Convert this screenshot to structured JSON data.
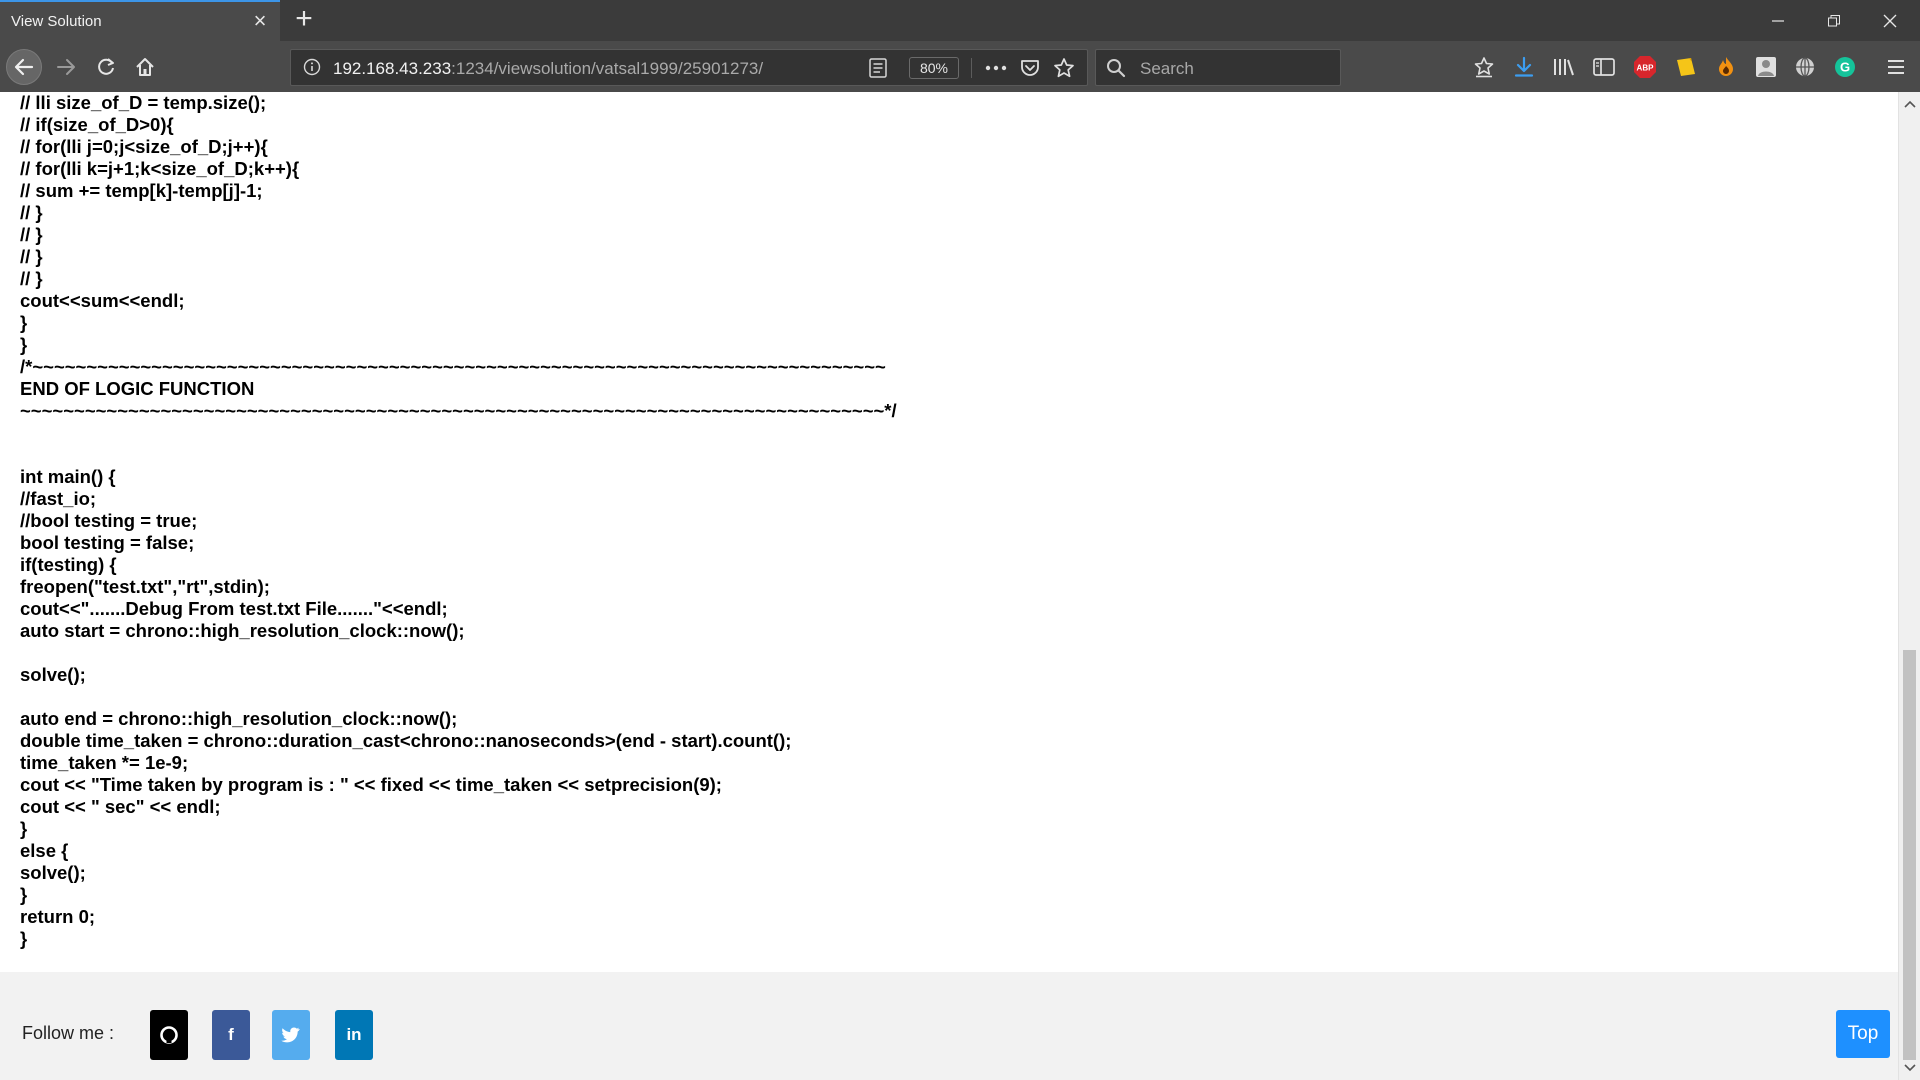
{
  "browser": {
    "tab_title": "View Solution",
    "url_host": "192.168.43.233",
    "url_path": ":1234/viewsolution/vatsal1999/25901273/",
    "zoom": "80%",
    "search_placeholder": "Search",
    "abp_label": "ABP",
    "grammarly_label": "G"
  },
  "code_lines": [
    "// lli size_of_D = temp.size();",
    "// if(size_of_D>0){",
    "// for(lli j=0;j<size_of_D;j++){",
    "// for(lli k=j+1;k<size_of_D;k++){",
    "// sum += temp[k]-temp[j]-1;",
    "// }",
    "// }",
    "// }",
    "// }",
    "cout<<sum<<endl;",
    "}",
    "}",
    "/*~~~~~~~~~~~~~~~~~~~~~~~~~~~~~~~~~~~~~~~~~~~~~~~~~~~~~~~~~~~~~~~~~~~~~~~~~~~~~~~",
    "END OF LOGIC FUNCTION",
    "~~~~~~~~~~~~~~~~~~~~~~~~~~~~~~~~~~~~~~~~~~~~~~~~~~~~~~~~~~~~~~~~~~~~~~~~~~~~~~~~*/",
    "",
    "",
    "int main() {",
    "//fast_io;",
    "//bool testing = true;",
    "bool testing = false;",
    "if(testing) {",
    "freopen(\"test.txt\",\"rt\",stdin);",
    "cout<<\".......Debug From test.txt File.......\"<<endl;",
    "auto start = chrono::high_resolution_clock::now();",
    "",
    "solve();",
    "",
    "auto end = chrono::high_resolution_clock::now();",
    "double time_taken = chrono::duration_cast<chrono::nanoseconds>(end - start).count();",
    "time_taken *= 1e-9;",
    "cout << \"Time taken by program is : \" << fixed << time_taken << setprecision(9);",
    "cout << \" sec\" << endl;",
    "}",
    "else {",
    "solve();",
    "}",
    "return 0;",
    "}"
  ],
  "footer": {
    "follow_label": "Follow me :",
    "social": [
      {
        "name": "github",
        "color": "#000000"
      },
      {
        "name": "facebook",
        "color": "#3b5998"
      },
      {
        "name": "twitter",
        "color": "#55acee"
      },
      {
        "name": "linkedin",
        "color": "#0077b5"
      }
    ],
    "facebook_glyph": "f",
    "linkedin_glyph": "in",
    "top_label": "Top"
  },
  "colors": {
    "chrome_dark": "#3b3b3b",
    "chrome": "#4a4a4a",
    "accent": "#3c95e8",
    "top_button": "#1e90ff"
  }
}
